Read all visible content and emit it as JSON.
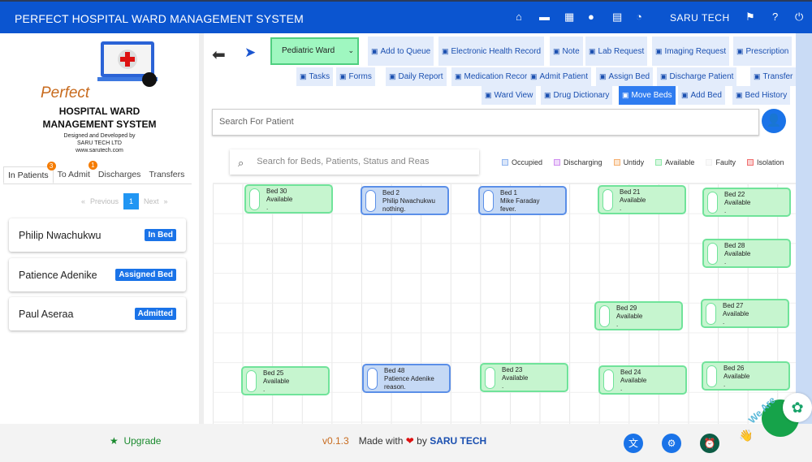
{
  "header": {
    "title": "PERFECT HOSPITAL WARD MANAGEMENT SYSTEM",
    "user": "SARU TECH",
    "icons": [
      "hospital-icon",
      "bed-icon",
      "building-icon",
      "list-icon",
      "cash-register-icon",
      "pie-chart-icon"
    ],
    "right_icons": [
      "flag-icon",
      "help-icon",
      "power-icon"
    ]
  },
  "sidebar": {
    "logo_word": "Perfect",
    "title1": "HOSPITAL WARD",
    "title2": "MANAGEMENT SYSTEM",
    "credit1": "Designed and Developed by",
    "credit2": "SARU TECH LTD",
    "credit3": "www.sarutech.com",
    "tabs": [
      {
        "label": "In Patients",
        "badge": "3"
      },
      {
        "label": "To Admit",
        "badge": "1"
      },
      {
        "label": "Discharges"
      },
      {
        "label": "Transfers"
      }
    ],
    "pager": {
      "prev": "Previous",
      "page": "1",
      "next": "Next"
    },
    "patients": [
      {
        "name": "Philip Nwachukwu",
        "status": "In Bed"
      },
      {
        "name": "Patience Adenike",
        "status": "Assigned Bed"
      },
      {
        "name": "Paul Aseraa",
        "status": "Admitted"
      }
    ]
  },
  "toolbar": {
    "ward": "Pediatric Ward",
    "row1": [
      "Add to Queue",
      "Electronic Health Record",
      "Note",
      "Lab Request",
      "Imaging Request",
      "Prescription"
    ],
    "row2": [
      "Tasks",
      "Forms",
      "Daily Report",
      "Medication Record",
      "Admit Patient",
      "Assign Bed",
      "Discharge Patient",
      "Transfer"
    ],
    "row3": [
      "Ward View",
      "Drug Dictionary",
      "Move Beds",
      "Add Bed",
      "Bed History"
    ],
    "active": "Move Beds"
  },
  "search": {
    "patient_placeholder": "Search For Patient",
    "bed_placeholder": "Search for Beds, Patients, Status and Reas"
  },
  "legend": [
    {
      "label": "Occupied",
      "color": "#8fb4ee"
    },
    {
      "label": "Discharging",
      "color": "#d08ef0"
    },
    {
      "label": "Untidy",
      "color": "#f5b070"
    },
    {
      "label": "Available",
      "color": "#8ee8a8"
    },
    {
      "label": "Faulty",
      "color": "#f0f0f0"
    },
    {
      "label": "Isolation",
      "color": "#f07070"
    }
  ],
  "beds": [
    {
      "name": "Bed 30",
      "line2": "Available",
      "line3": ".",
      "status": "available"
    },
    {
      "name": "Bed 2",
      "line2": "Philip Nwachukwu",
      "line3": "nothing.",
      "status": "occupied"
    },
    {
      "name": "Bed 1",
      "line2": "Mike Faraday",
      "line3": "fever.",
      "status": "occupied"
    },
    {
      "name": "Bed 21",
      "line2": "Available",
      "line3": ".",
      "status": "available"
    },
    {
      "name": "Bed 22",
      "line2": "Available",
      "line3": ".",
      "status": "available"
    },
    {
      "name": "Bed 28",
      "line2": "Available",
      "line3": ".",
      "status": "available"
    },
    {
      "name": "Bed 29",
      "line2": "Available",
      "line3": ".",
      "status": "available"
    },
    {
      "name": "Bed 27",
      "line2": "Available",
      "line3": ".",
      "status": "available"
    },
    {
      "name": "Bed 25",
      "line2": "Available",
      "line3": ".",
      "status": "available"
    },
    {
      "name": "Bed 48",
      "line2": "Patience Adenike",
      "line3": "reason.",
      "status": "occupied"
    },
    {
      "name": "Bed 23",
      "line2": "Available",
      "line3": ".",
      "status": "available"
    },
    {
      "name": "Bed 24",
      "line2": "Available",
      "line3": ".",
      "status": "available"
    },
    {
      "name": "Bed 26",
      "line2": "Available",
      "line3": ".",
      "status": "available"
    }
  ],
  "footer": {
    "upgrade": "Upgrade",
    "version": "v0.1.3",
    "made_with": "Made with",
    "by": "by",
    "brand": "SARU TECH",
    "chat_text": "We Are"
  }
}
